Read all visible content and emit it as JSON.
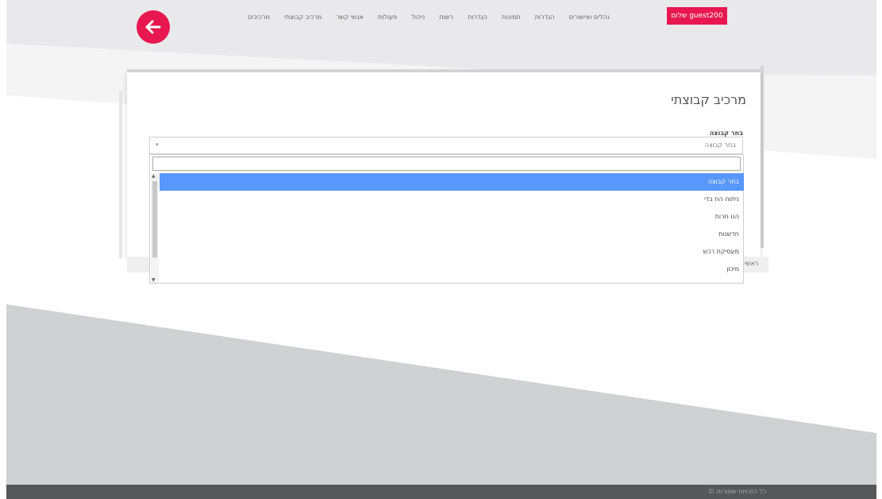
{
  "header": {
    "user_button": "שלום guest200",
    "nav_items": [
      "מרכיבים",
      "מרכיב קבוצתי",
      "אנשי קשר",
      "פעולות",
      "ניהול",
      "רשות",
      "הגדרות",
      "תמונות",
      "הגדרות",
      "נהלים ואישורים"
    ],
    "back_icon": "arrow-left-icon",
    "accent_color": "#e8174f"
  },
  "card": {
    "title": "מרכיב קבוצתי",
    "field_label": "בחר קבוצה",
    "select_value": "בחר קבוצה",
    "search_value": "",
    "footer_text": "ראשי"
  },
  "dropdown": {
    "options": [
      {
        "label": "בחר קבוצה",
        "selected": true
      },
      {
        "label": "ניתוח הח בדי",
        "selected": false
      },
      {
        "label": "הנו חרות",
        "selected": false
      },
      {
        "label": "חדשנות",
        "selected": false
      },
      {
        "label": "מעסיקת רכש",
        "selected": false
      },
      {
        "label": "מיכון",
        "selected": false
      }
    ]
  },
  "footer": {
    "copyright": "© כל הזכויות שמורות"
  }
}
